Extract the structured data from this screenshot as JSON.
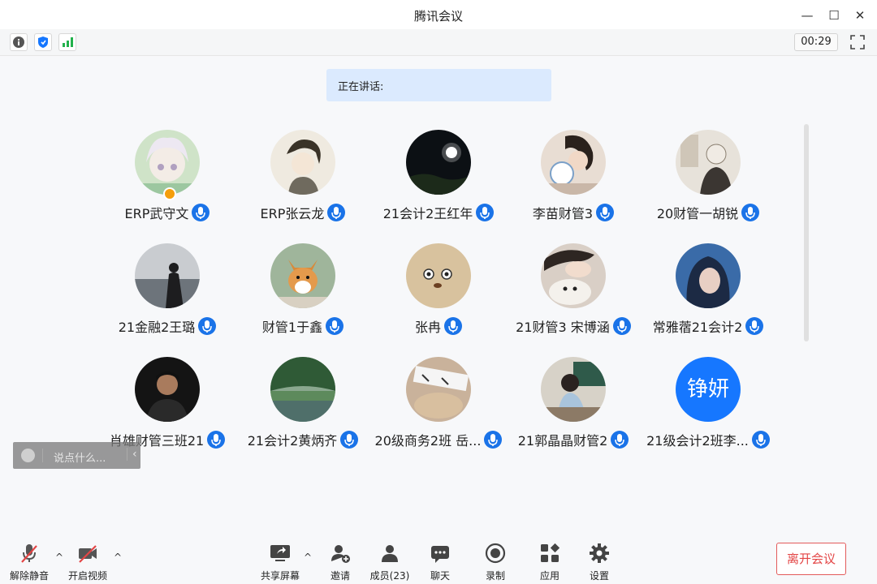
{
  "window": {
    "title": "腾讯会议",
    "minimize_glyph": "—",
    "maximize_glyph": "☐",
    "close_glyph": "✕"
  },
  "infobar": {
    "timer": "00:29",
    "icons": [
      "info-icon",
      "shield-icon",
      "signal-icon"
    ]
  },
  "speaking": {
    "label": "正在讲话:"
  },
  "participants": [
    {
      "name": "ERP武守文",
      "avatar": "anime-girl"
    },
    {
      "name": "ERP张云龙",
      "avatar": "anime-boy",
      "host": true
    },
    {
      "name": "21会计2王红年",
      "avatar": "night-moon"
    },
    {
      "name": "李苗财管3",
      "avatar": "girl-photo"
    },
    {
      "name": "20财管一胡锐",
      "avatar": "sketch"
    },
    {
      "name": "21金融2王璐",
      "avatar": "seaside-person"
    },
    {
      "name": "财管1于鑫",
      "avatar": "corgi"
    },
    {
      "name": "张冉",
      "avatar": "cartoon-bear"
    },
    {
      "name": "21财管3 宋博涵",
      "avatar": "girl-with-dog"
    },
    {
      "name": "常雅蓿21会计2",
      "avatar": "girl-blue"
    },
    {
      "name": "肖雄财管三班21",
      "avatar": "basketball-player"
    },
    {
      "name": "21会计2黄炳齐",
      "avatar": "lake-forest"
    },
    {
      "name": "20级商务2班 岳...",
      "avatar": "hand-drawing"
    },
    {
      "name": "21郭晶晶财管2",
      "avatar": "classroom"
    },
    {
      "name": "21级会计2班李...",
      "avatar": "text",
      "avatar_text": "铮妍"
    }
  ],
  "chat": {
    "placeholder": "说点什么...",
    "arrow": "‹"
  },
  "toolbar": {
    "unmute": "解除静音",
    "start_video": "开启视频",
    "share_screen": "共享屏幕",
    "invite": "邀请",
    "members": "成员(23)",
    "chat": "聊天",
    "record": "录制",
    "apps": "应用",
    "settings": "设置",
    "leave": "离开会议",
    "caret": "^"
  },
  "colors": {
    "accent": "#1677ff",
    "mic_blue": "#1a73e8",
    "leave_red": "#e34545",
    "speaking_bg": "#dbeafe"
  }
}
